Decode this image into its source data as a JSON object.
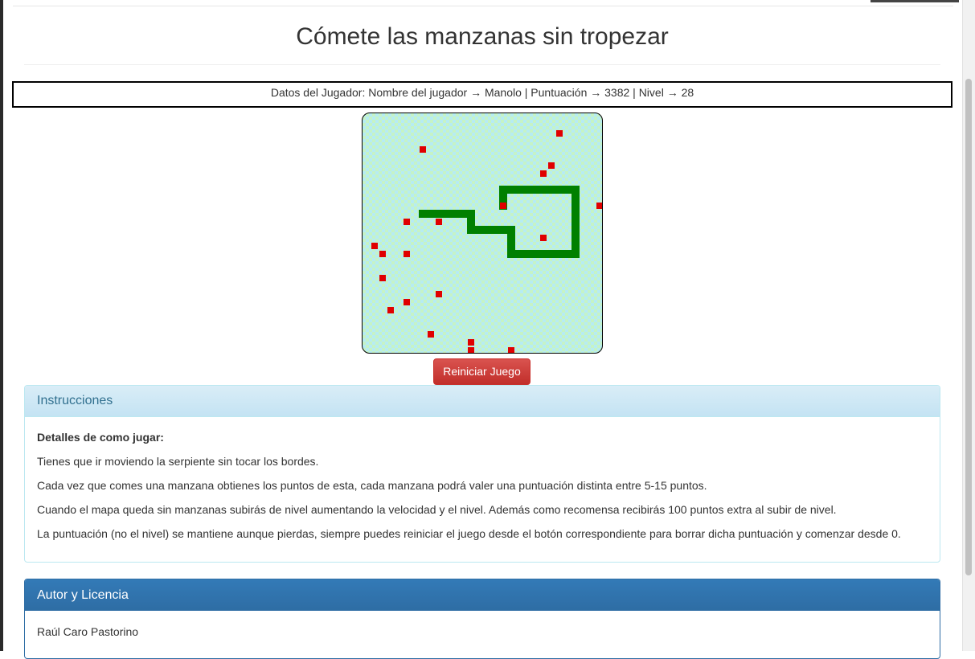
{
  "page": {
    "title": "Cómete las manzanas sin tropezar"
  },
  "player": {
    "summary": "Datos del Jugador: Nombre del jugador → Manolo | Puntuación → 3382 | Nivel → 28"
  },
  "game": {
    "board_colors": {
      "tile_a": "#b6ecf3",
      "tile_b": "#c6f3c6",
      "snake": "#008000",
      "apple": "#e00000"
    },
    "snake_cells": [
      [
        7,
        12
      ],
      [
        8,
        12
      ],
      [
        9,
        12
      ],
      [
        10,
        12
      ],
      [
        11,
        12
      ],
      [
        12,
        12
      ],
      [
        13,
        12
      ],
      [
        13,
        13
      ],
      [
        13,
        14
      ],
      [
        14,
        14
      ],
      [
        15,
        14
      ],
      [
        16,
        14
      ],
      [
        17,
        14
      ],
      [
        18,
        14
      ],
      [
        18,
        15
      ],
      [
        18,
        16
      ],
      [
        18,
        17
      ],
      [
        19,
        17
      ],
      [
        20,
        17
      ],
      [
        21,
        17
      ],
      [
        22,
        17
      ],
      [
        23,
        17
      ],
      [
        24,
        17
      ],
      [
        25,
        17
      ],
      [
        26,
        17
      ],
      [
        26,
        16
      ],
      [
        26,
        15
      ],
      [
        26,
        14
      ],
      [
        26,
        13
      ],
      [
        26,
        12
      ],
      [
        26,
        11
      ],
      [
        26,
        10
      ],
      [
        26,
        9
      ],
      [
        25,
        9
      ],
      [
        24,
        9
      ],
      [
        23,
        9
      ],
      [
        22,
        9
      ],
      [
        21,
        9
      ],
      [
        20,
        9
      ],
      [
        19,
        9
      ],
      [
        18,
        9
      ],
      [
        17,
        9
      ],
      [
        17,
        10
      ],
      [
        17,
        11
      ]
    ],
    "apples": [
      [
        24,
        2
      ],
      [
        7,
        4
      ],
      [
        23,
        6
      ],
      [
        22,
        7
      ],
      [
        17,
        11
      ],
      [
        29,
        11
      ],
      [
        5,
        13
      ],
      [
        9,
        13
      ],
      [
        22,
        15
      ],
      [
        1,
        16
      ],
      [
        2,
        17
      ],
      [
        5,
        17
      ],
      [
        2,
        20
      ],
      [
        9,
        22
      ],
      [
        3,
        24
      ],
      [
        5,
        23
      ],
      [
        8,
        27
      ],
      [
        13,
        28
      ],
      [
        13,
        29
      ],
      [
        18,
        29
      ]
    ],
    "restart_label": "Reiniciar Juego"
  },
  "instructions": {
    "heading": "Instrucciones",
    "subtitle": "Detalles de como jugar:",
    "lines": [
      "Tienes que ir moviendo la serpiente sin tocar los bordes.",
      "Cada vez que comes una manzana obtienes los puntos de esta, cada manzana podrá valer una puntuación distinta entre 5-15 puntos.",
      "Cuando el mapa queda sin manzanas subirás de nivel aumentando la velocidad y el nivel. Además como recomensa recibirás 100 puntos extra al subir de nivel.",
      "La puntuación (no el nivel) se mantiene aunque pierdas, siempre puedes reiniciar el juego desde el botón correspondiente para borrar dicha puntuación y comenzar desde 0."
    ]
  },
  "author": {
    "heading": "Autor y Licencia",
    "name": "Raúl Caro Pastorino"
  }
}
